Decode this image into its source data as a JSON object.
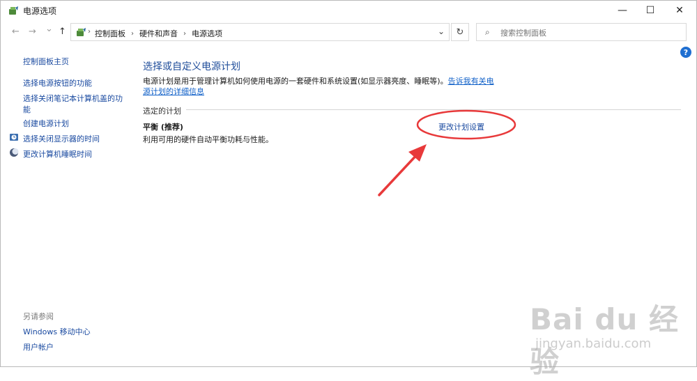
{
  "window": {
    "title": "电源选项",
    "minimize_glyph": "—",
    "maximize_glyph": "☐",
    "close_glyph": "✕"
  },
  "toolbar": {
    "back_glyph": "←",
    "forward_glyph": "→",
    "recent_glyph": "⌄",
    "up_glyph": "↑",
    "refresh_glyph": "↻",
    "dropdown_glyph": "⌄"
  },
  "breadcrumb": {
    "items": [
      "控制面板",
      "硬件和声音",
      "电源选项"
    ],
    "separator": "›"
  },
  "search": {
    "placeholder": "搜索控制面板"
  },
  "help": {
    "glyph": "?"
  },
  "sidebar": {
    "home": "控制面板主页",
    "items": [
      "选择电源按钮的功能",
      "选择关闭笔记本计算机盖的功",
      "能",
      "创建电源计划",
      "选择关闭显示器的时间",
      "更改计算机睡眠时间"
    ],
    "see_also_title": "另请参阅",
    "see_also": [
      "Windows 移动中心",
      "用户帐户"
    ]
  },
  "main": {
    "heading": "选择或自定义电源计划",
    "description": "电源计划是用于管理计算机如何使用电源的一套硬件和系统设置(如显示器亮度、睡眠等)。",
    "description_link": "告诉我有关电源计划的详细信息",
    "section_title": "选定的计划",
    "plan_name": "平衡 (推荐)",
    "plan_description": "利用可用的硬件自动平衡功耗与性能。",
    "plan_link": "更改计划设置"
  },
  "annotation": {
    "color": "#e8393a"
  },
  "watermark": {
    "logo": "Bai du 经验",
    "url": "jingyan.baidu.com"
  },
  "colors": {
    "link": "#1a4aa0",
    "heading": "#1e4c9a",
    "accent": "#1f6fd1"
  }
}
